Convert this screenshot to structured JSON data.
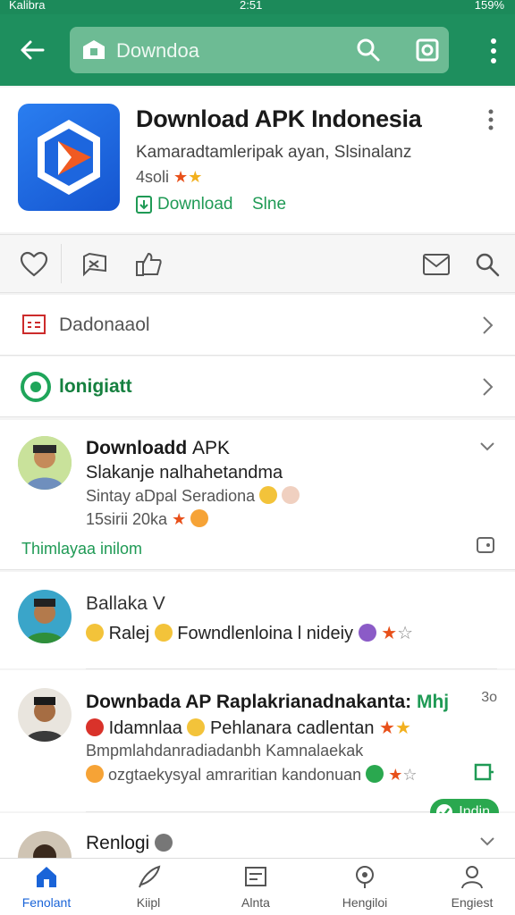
{
  "status_bar": {
    "left": "Kalibra",
    "time": "2:51",
    "battery": "159%"
  },
  "app_bar": {
    "search_text": "Downdoa"
  },
  "app": {
    "title": "Download APK Indonesia",
    "subtitle": "Kamaradtamleripak ayan, Slsinalanz",
    "rating_text": "4soli",
    "download_label": "Download",
    "slide_label": "Slne"
  },
  "rows": [
    {
      "label": "Dadonaaol"
    },
    {
      "label": "lonigiatt"
    }
  ],
  "reviews": [
    {
      "name": "Downloadd",
      "name_suffix": "APK",
      "line1": "Slakanje nalhahetandma",
      "line2": "Sintay aDpal Seradiona",
      "meta": "15sirii 20ka",
      "footer_link": "Thimlayaa inilom"
    },
    {
      "name": "Ballaka",
      "name_suffix": "V",
      "line1": "Ralej",
      "line1_rest": "Fowndlenloina l nideiy"
    },
    {
      "name": "Downbada AP",
      "name_rest": "Raplakrianadnakanta:",
      "name_green": "Mhj",
      "line1": "Idamnlaa",
      "line1_rest": "Pehlanara cadlentan",
      "line2": "Bmpmlahdanradiadanbh Kamnalaekak",
      "line3": "ozgtaekysyal amraritian kandonuan",
      "corner": "3o"
    },
    {
      "name": "Renlogi"
    }
  ],
  "badge_label": "Indin",
  "nav": [
    {
      "label": "Fenolant"
    },
    {
      "label": "Kiipl"
    },
    {
      "label": "Alnta"
    },
    {
      "label": "Hengiloi"
    },
    {
      "label": "Engiest"
    }
  ],
  "colors": {
    "brand_green": "#1e8f5e",
    "accent_blue": "#1a64d8",
    "star_orange": "#e8501a"
  }
}
